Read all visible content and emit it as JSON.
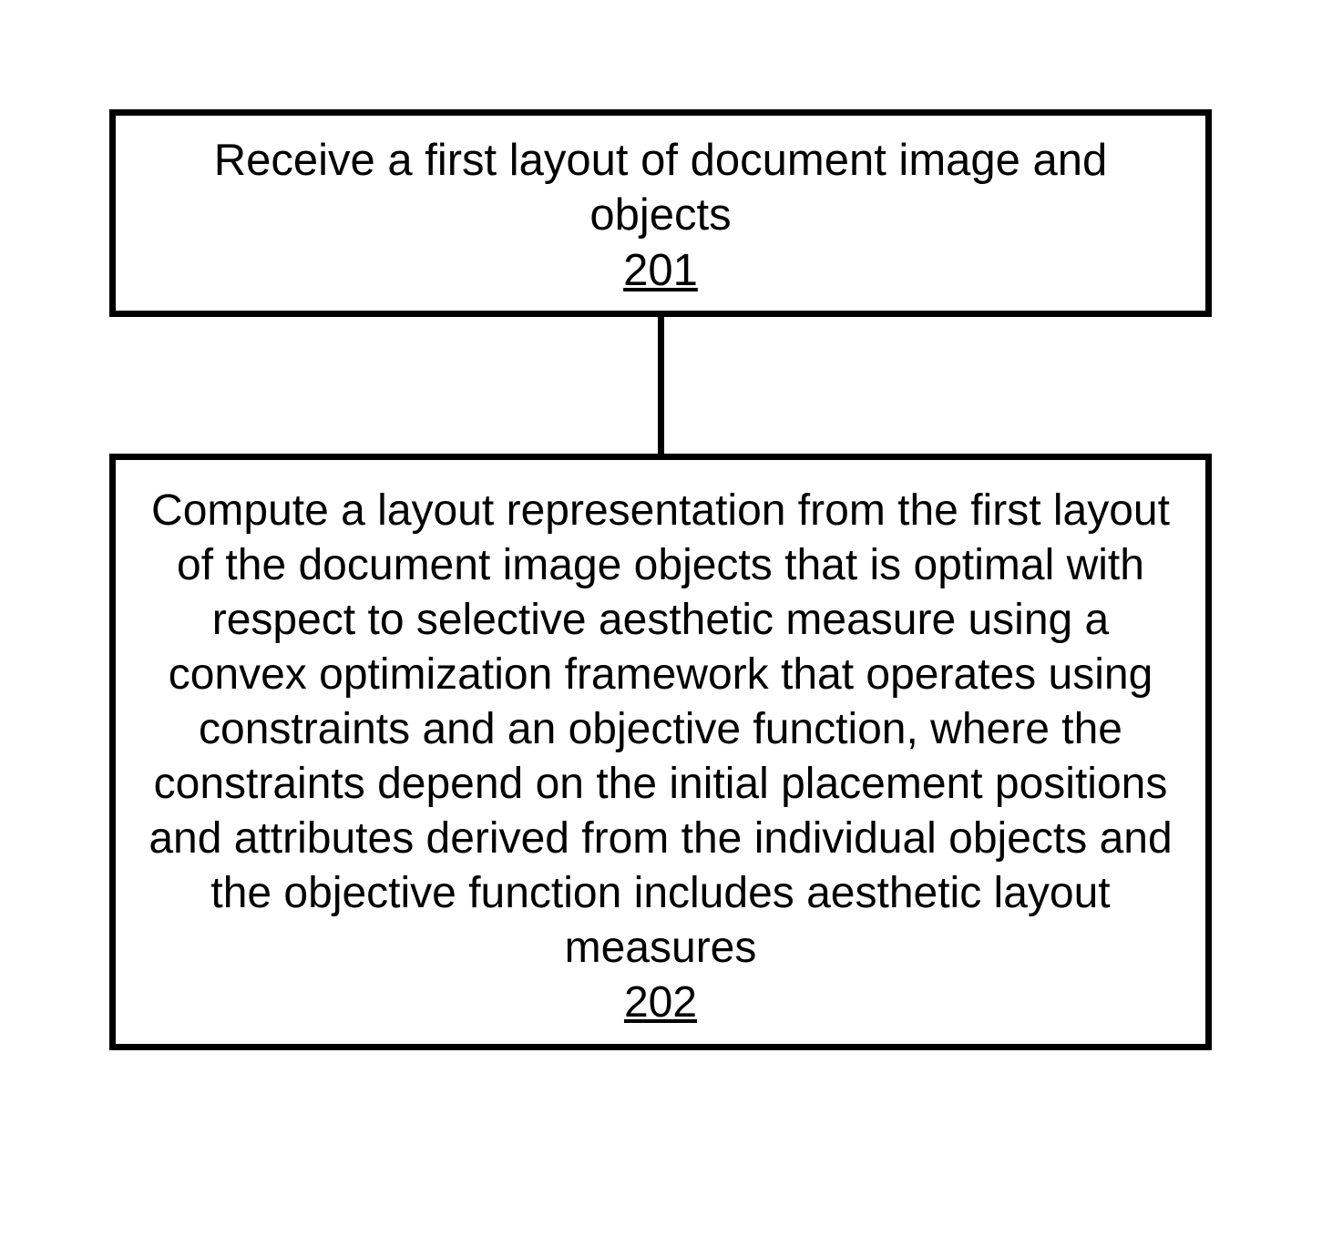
{
  "flow": {
    "step1": {
      "text": "Receive a first layout of document image and objects",
      "ref": "201"
    },
    "step2": {
      "text": "Compute a layout representation from the first layout of the document image objects that is optimal with respect to selective aesthetic measure using a convex optimization framework that operates using constraints and an objective function, where the constraints depend on the initial placement positions and attributes derived from the individual objects and the objective function includes aesthetic layout measures",
      "ref": "202"
    }
  }
}
